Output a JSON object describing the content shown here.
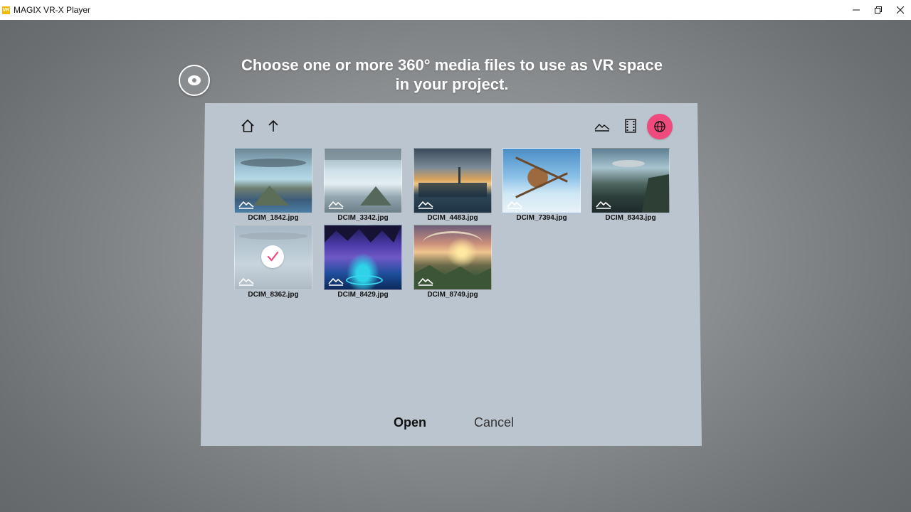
{
  "window": {
    "title": "MAGIX VR-X Player",
    "logo_text": "VR",
    "controls": [
      "minimize",
      "restore",
      "close"
    ]
  },
  "dialog": {
    "heading": "Choose one or more 360° media files to use as VR space in your project.",
    "toolbar": {
      "left": [
        "home-icon",
        "up-arrow-icon"
      ],
      "right": [
        "mountain-icon",
        "film-strip-icon",
        "globe-icon"
      ],
      "active_filter": "globe-icon",
      "accent_color": "#ef4a7d"
    },
    "files": [
      {
        "name": "DCIM_1842.jpg",
        "type": "image",
        "selected": false
      },
      {
        "name": "DCIM_3342.jpg",
        "type": "image",
        "selected": false
      },
      {
        "name": "DCIM_4483.jpg",
        "type": "image",
        "selected": false
      },
      {
        "name": "DCIM_7394.jpg",
        "type": "image",
        "selected": false
      },
      {
        "name": "DCIM_8343.jpg",
        "type": "image",
        "selected": false
      },
      {
        "name": "DCIM_8362.jpg",
        "type": "image",
        "selected": true
      },
      {
        "name": "DCIM_8429.jpg",
        "type": "image",
        "selected": false
      },
      {
        "name": "DCIM_8749.jpg",
        "type": "image",
        "selected": false
      }
    ],
    "buttons": {
      "open": "Open",
      "cancel": "Cancel"
    }
  }
}
